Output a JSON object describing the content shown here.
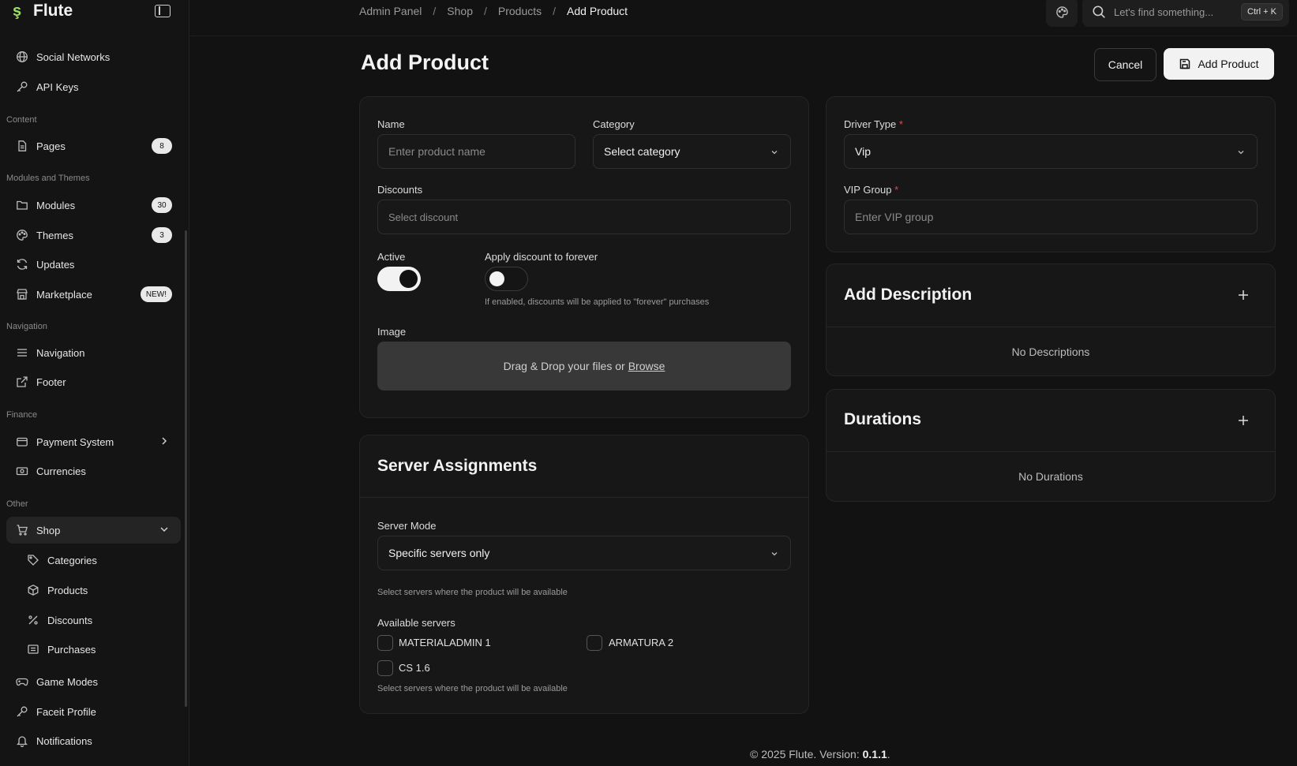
{
  "app": {
    "name": "Flute"
  },
  "sidebar": {
    "sections": {
      "content": "Content",
      "modules": "Modules and Themes",
      "navigation": "Navigation",
      "finance": "Finance",
      "other": "Other"
    },
    "items": {
      "social": {
        "label": "Social Networks",
        "icon": "globe-icon"
      },
      "api": {
        "label": "API Keys",
        "icon": "key-icon"
      },
      "pages": {
        "label": "Pages",
        "icon": "file-icon",
        "badge": "8"
      },
      "modules": {
        "label": "Modules",
        "icon": "folder-icon",
        "badge": "30"
      },
      "themes": {
        "label": "Themes",
        "icon": "palette-icon",
        "badge": "3"
      },
      "updates": {
        "label": "Updates",
        "icon": "refresh-icon"
      },
      "marketplace": {
        "label": "Marketplace",
        "icon": "store-icon",
        "badge": "NEW!"
      },
      "navigation": {
        "label": "Navigation",
        "icon": "menu-icon"
      },
      "footer": {
        "label": "Footer",
        "icon": "external-link-icon"
      },
      "payment": {
        "label": "Payment System",
        "icon": "wallet-icon"
      },
      "currencies": {
        "label": "Currencies",
        "icon": "money-icon"
      },
      "shop": {
        "label": "Shop",
        "icon": "cart-icon"
      },
      "categories": {
        "label": "Categories",
        "icon": "tag-icon"
      },
      "products": {
        "label": "Products",
        "icon": "box-icon"
      },
      "discounts": {
        "label": "Discounts",
        "icon": "percent-icon"
      },
      "purchases": {
        "label": "Purchases",
        "icon": "receipt-icon"
      },
      "gamemodes": {
        "label": "Game Modes",
        "icon": "gamepad-icon"
      },
      "faceit": {
        "label": "Faceit Profile",
        "icon": "key-icon"
      },
      "notifications": {
        "label": "Notifications",
        "icon": "bell-icon"
      }
    }
  },
  "topbar": {
    "breadcrumb": [
      "Admin Panel",
      "Shop",
      "Products",
      "Add Product"
    ],
    "search_placeholder": "Let's find something...",
    "search_shortcut": "Ctrl + K"
  },
  "page": {
    "title": "Add Product",
    "cancel_label": "Cancel",
    "add_label": "Add Product"
  },
  "form": {
    "name_label": "Name",
    "name_placeholder": "Enter product name",
    "category_label": "Category",
    "category_value": "Select category",
    "discounts_label": "Discounts",
    "discounts_placeholder": "Select discount",
    "active_label": "Active",
    "active_on": true,
    "forever_label": "Apply discount to forever",
    "forever_on": false,
    "forever_hint": "If enabled, discounts will be applied to \"forever\" purchases",
    "image_label": "Image",
    "dropzone_text": "Drag & Drop your files or",
    "dropzone_link": "Browse"
  },
  "servers": {
    "title": "Server Assignments",
    "mode_label": "Server Mode",
    "mode_value": "Specific servers only",
    "mode_hint": "Select servers where the product will be available",
    "available_label": "Available servers",
    "list": [
      "MATERIALADMIN 1",
      "ARMATURA 2",
      "CS 1.6"
    ],
    "list_hint": "Select servers where the product will be available"
  },
  "driver": {
    "type_label": "Driver Type",
    "type_value": "Vip",
    "group_label": "VIP Group",
    "group_placeholder": "Enter VIP group"
  },
  "description": {
    "title": "Add Description",
    "empty": "No Descriptions"
  },
  "durations": {
    "title": "Durations",
    "empty": "No Durations"
  },
  "footer": {
    "text": "© 2025 Flute. Version:",
    "version": "0.1.1",
    "tail": "."
  }
}
